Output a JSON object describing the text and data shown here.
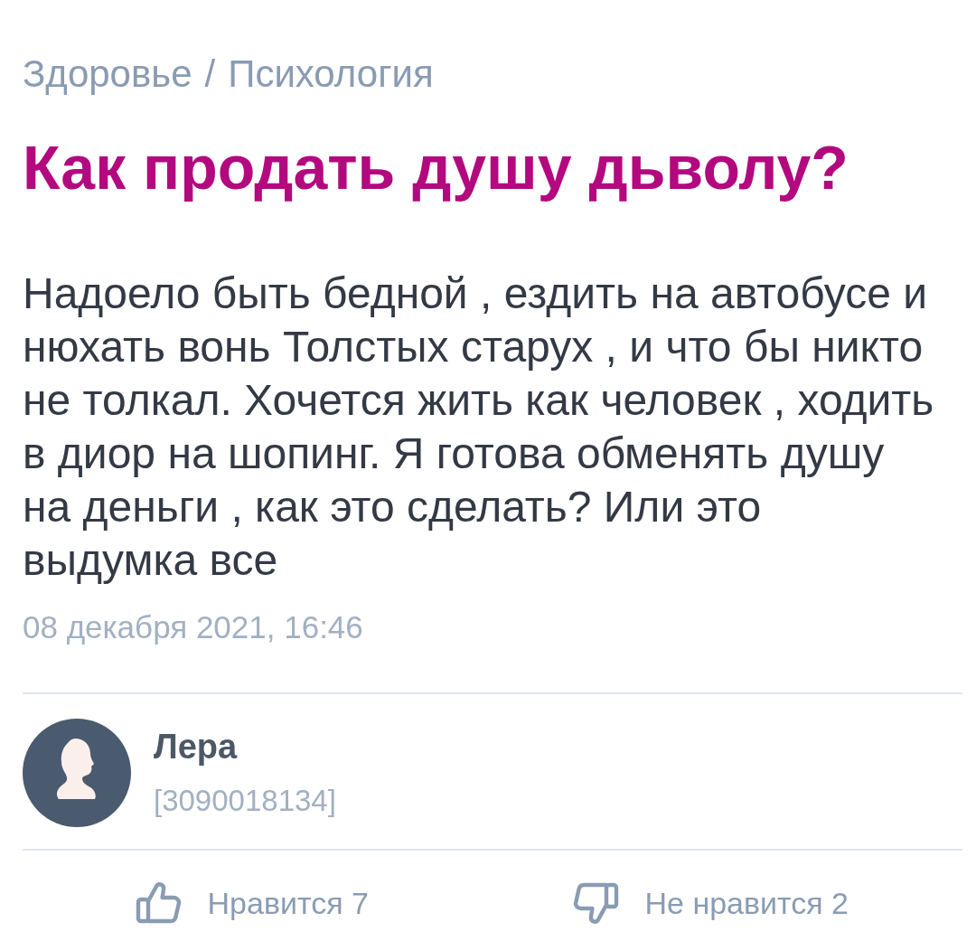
{
  "breadcrumb": {
    "items": [
      {
        "label": "Здоровье"
      },
      {
        "label": "Психология"
      }
    ],
    "separator": "/"
  },
  "question": {
    "title": "Как продать душу дьволу?",
    "body": "Надоело быть бедной , ездить на автобусе и нюхать вонь Толстых старух , и что бы никто не толкал. Хочется жить как человек , ходить в диор на шопинг. Я готова обменять душу на деньги , как это сделать? Или это выдумка все",
    "date": "08 декабря 2021, 16:46"
  },
  "author": {
    "name": "Лера",
    "id": "[3090018134]"
  },
  "reactions": [
    {
      "kind": "like",
      "label": "Нравится 7"
    },
    {
      "kind": "dislike",
      "label": "Не нравится 2"
    }
  ]
}
